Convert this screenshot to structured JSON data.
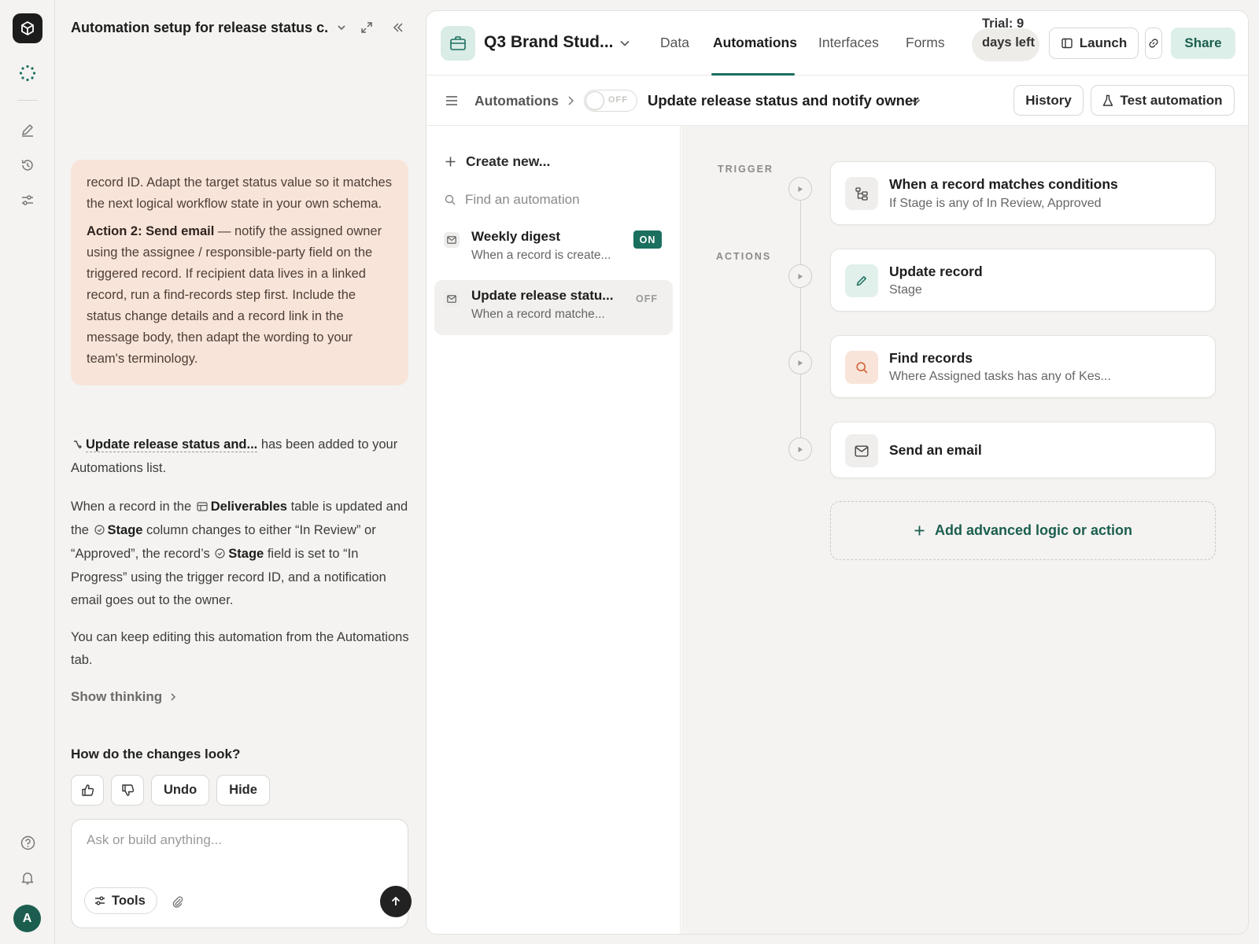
{
  "chat": {
    "title": "Automation setup for release status c...",
    "bubble": {
      "p1": "record ID. Adapt the target status value so it matches the next logical workflow state in your own schema.",
      "p2_bold": "Action 2: Send email",
      "p2_rest": " — notify the assigned owner using the assignee / responsible-party field on the triggered record. If recipient data lives in a linked record, run a find-records step first. Include the status change details and a record link in the message body, then adapt the wording to your team's terminology."
    },
    "added_msg": {
      "link": "Update release status and...",
      "rest": " has been added to your Automations list."
    },
    "summary": {
      "s1": "When a record in the ",
      "table": "Deliverables",
      "s2": " table is updated and the ",
      "field1": "Stage",
      "s3": " column changes to either “In Review” or “Approved”, the record’s ",
      "field2": "Stage",
      "s4": " field is set to “In Progress” using the trigger record ID, and a notification email goes out to the owner."
    },
    "keep_editing": "You can keep editing this automation from the Automations tab.",
    "show_thinking": "Show thinking",
    "feedback_question": "How do the changes look?",
    "undo_label": "Undo",
    "hide_label": "Hide",
    "composer_placeholder": "Ask or build anything...",
    "tools_label": "Tools"
  },
  "rail": {
    "avatar_initial": "A"
  },
  "app": {
    "base_name": "Q3 Brand Stud...",
    "tabs": [
      {
        "label": "Data"
      },
      {
        "label": "Automations"
      },
      {
        "label": "Interfaces"
      },
      {
        "label": "Forms"
      }
    ],
    "trial": "Trial: 9 days left",
    "launch_label": "Launch",
    "share_label": "Share",
    "breadcrumb": "Automations",
    "toggle_state": "OFF",
    "automation_title": "Update release status and notify owner",
    "history_label": "History",
    "test_label": "Test automation",
    "create_new": "Create new...",
    "find_placeholder": "Find an automation",
    "automations": [
      {
        "name": "Weekly digest",
        "sub": "When a record is create...",
        "status": "ON"
      },
      {
        "name": "Update release statu...",
        "sub": "When a record matche...",
        "status": "OFF"
      }
    ],
    "trigger_label": "TRIGGER",
    "actions_label": "ACTIONS",
    "trigger": {
      "title": "When a record matches conditions",
      "sub": "If Stage is any of In Review, Approved"
    },
    "actions": [
      {
        "title": "Update record",
        "sub": "Stage"
      },
      {
        "title": "Find records",
        "sub": "Where Assigned tasks has any of Kes..."
      },
      {
        "title": "Send an email",
        "sub": ""
      }
    ],
    "add_logic": "Add advanced logic or action"
  },
  "colors": {
    "accent": "#1b6f5f",
    "bubble_bg": "#f9e4d9",
    "share_bg": "#dcefe8"
  }
}
